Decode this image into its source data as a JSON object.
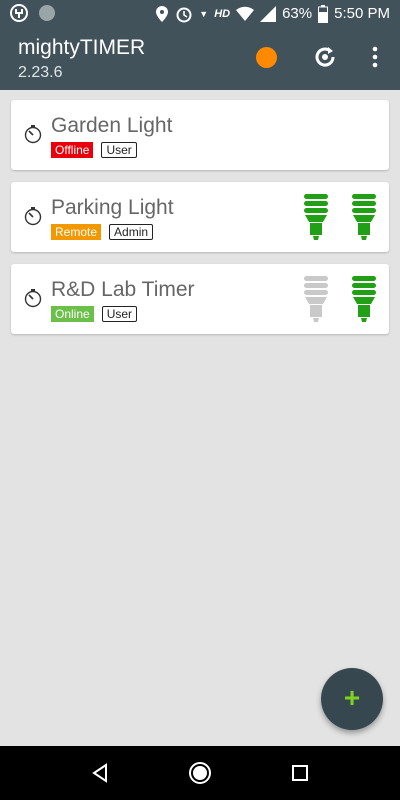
{
  "status_bar": {
    "battery": "63%",
    "time": "5:50 PM",
    "network": "HD",
    "icons": [
      "usb-icon",
      "circle-icon",
      "location-icon",
      "alarm-icon",
      "wifi-icon",
      "signal-icon",
      "battery-icon"
    ]
  },
  "app_bar": {
    "title": "mightyTIMER",
    "version": "2.23.6",
    "status_dot_color": "#ff8a00",
    "icons": [
      "refresh-icon",
      "more-vert-icon"
    ]
  },
  "timers": [
    {
      "name": "Garden Light",
      "status": "Offline",
      "status_color": "#e8000b",
      "role": "User",
      "bulbs": []
    },
    {
      "name": "Parking Light",
      "status": "Remote",
      "status_color": "#f39800",
      "role": "Admin",
      "bulbs": [
        "on",
        "on"
      ]
    },
    {
      "name": "R&D Lab Timer",
      "status": "Online",
      "status_color": "#6cc04a",
      "role": "User",
      "bulbs": [
        "off",
        "on"
      ]
    }
  ],
  "colors": {
    "bulb_on": "#22a015",
    "bulb_off": "#c9c9c9",
    "fab": "#37474f",
    "fab_plus": "#7ed321"
  },
  "fab": {
    "label": "+"
  },
  "nav": [
    "back-icon",
    "home-icon",
    "recents-icon"
  ]
}
